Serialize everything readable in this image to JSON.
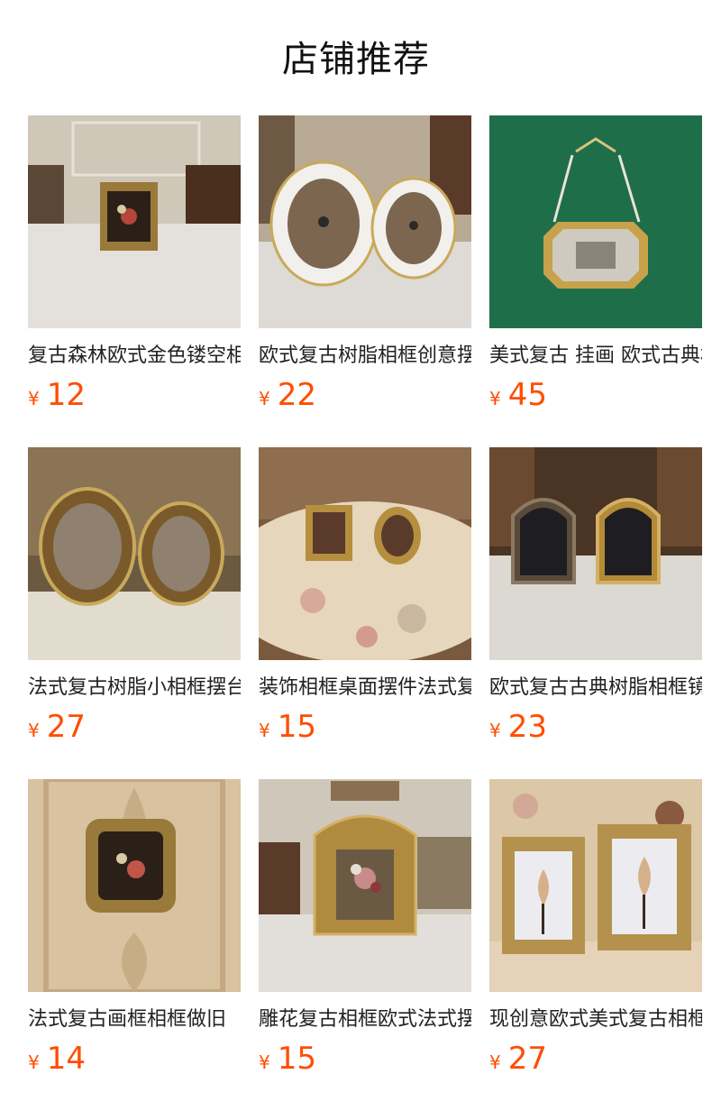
{
  "page": {
    "title": "店铺推荐"
  },
  "products": [
    {
      "name": "复古森林欧式金色镂空相框",
      "currency": "¥",
      "price": "12",
      "image": "gold-frame-floral-on-table"
    },
    {
      "name": "欧式复古树脂相框创意摆件",
      "currency": "¥",
      "price": "22",
      "image": "white-oval-frames-pair"
    },
    {
      "name": "美式复古 挂画 欧式古典相框",
      "currency": "¥",
      "price": "45",
      "image": "octagon-frame-on-green-wall"
    },
    {
      "name": "法式复古树脂小相框摆台",
      "currency": "¥",
      "price": "27",
      "image": "bronze-oval-frames-pair"
    },
    {
      "name": "装饰相框桌面摆件法式复古",
      "currency": "¥",
      "price": "15",
      "image": "small-frames-on-floral-tablecloth"
    },
    {
      "name": "欧式复古古典树脂相框镜子",
      "currency": "¥",
      "price": "23",
      "image": "ornate-mirror-frames-pair"
    },
    {
      "name": "法式复古画框相框做旧",
      "currency": "¥",
      "price": "14",
      "image": "square-frame-on-damask-wall"
    },
    {
      "name": "雕花复古相框欧式法式摆台",
      "currency": "¥",
      "price": "15",
      "image": "carved-gold-frame-flowers"
    },
    {
      "name": "现创意欧式美式复古相框",
      "currency": "¥",
      "price": "27",
      "image": "tulip-frames-pair"
    }
  ],
  "colors": {
    "price": "#ff4d00",
    "text": "#222222",
    "background": "#ffffff"
  }
}
